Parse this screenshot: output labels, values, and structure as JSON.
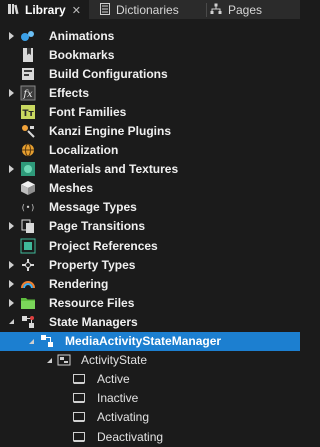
{
  "tabs": {
    "library": "Library",
    "dictionaries": "Dictionaries",
    "pages": "Pages"
  },
  "tree": [
    {
      "label": "Animations",
      "icon": "animations-icon"
    },
    {
      "label": "Bookmarks",
      "icon": "bookmarks-icon"
    },
    {
      "label": "Build Configurations",
      "icon": "build-configurations-icon"
    },
    {
      "label": "Effects",
      "icon": "effects-icon"
    },
    {
      "label": "Font Families",
      "icon": "font-families-icon"
    },
    {
      "label": "Kanzi Engine Plugins",
      "icon": "plugins-icon"
    },
    {
      "label": "Localization",
      "icon": "localization-icon"
    },
    {
      "label": "Materials and Textures",
      "icon": "materials-icon"
    },
    {
      "label": "Meshes",
      "icon": "meshes-icon"
    },
    {
      "label": "Message Types",
      "icon": "message-types-icon"
    },
    {
      "label": "Page Transitions",
      "icon": "page-transitions-icon"
    },
    {
      "label": "Project References",
      "icon": "project-references-icon"
    },
    {
      "label": "Property Types",
      "icon": "property-types-icon"
    },
    {
      "label": "Rendering",
      "icon": "rendering-icon"
    },
    {
      "label": "Resource Files",
      "icon": "resource-files-icon"
    },
    {
      "label": "State Managers",
      "icon": "state-managers-icon"
    },
    {
      "label": "MediaActivityStateManager",
      "icon": "state-manager-icon"
    },
    {
      "label": "ActivityState",
      "icon": "state-group-icon"
    },
    {
      "label": "Active",
      "icon": "state-icon"
    },
    {
      "label": "Inactive",
      "icon": "state-icon"
    },
    {
      "label": "Activating",
      "icon": "state-icon"
    },
    {
      "label": "Deactivating",
      "icon": "state-icon"
    }
  ],
  "colors": {
    "background": "#1b1b1b",
    "tabbar": "#2b2b2b",
    "selection": "#1c7fd0"
  }
}
